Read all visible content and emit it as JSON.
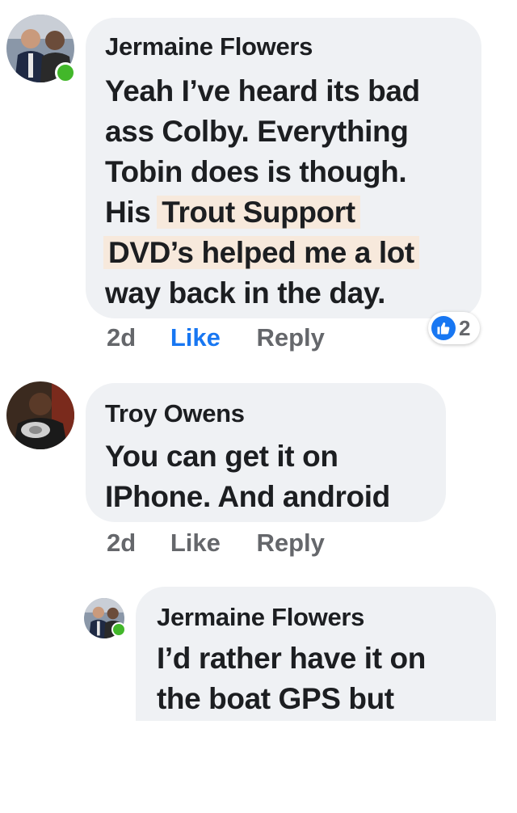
{
  "comments": [
    {
      "author": "Jermaine Flowers",
      "lines": [
        {
          "pre": "Yeah I’ve heard its bad",
          "hl": ""
        },
        {
          "pre": "ass Colby. Everything",
          "hl": ""
        },
        {
          "pre": "Tobin does is though.",
          "hl": ""
        },
        {
          "pre": "His",
          "hl": "Trout Support"
        },
        {
          "pre": "",
          "hl": "DVD’s helped me a lot"
        },
        {
          "pre": "way back in the day.",
          "hl": ""
        }
      ],
      "time": "2d",
      "like_label": "Like",
      "reply_label": "Reply",
      "reaction_count": "2",
      "online": true
    },
    {
      "author": "Troy Owens",
      "lines": [
        {
          "pre": "You can get it on",
          "hl": ""
        },
        {
          "pre": "IPhone. And android",
          "hl": ""
        }
      ],
      "time": "2d",
      "like_label": "Like",
      "reply_label": "Reply",
      "online": false
    },
    {
      "author": "Jermaine Flowers",
      "lines": [
        {
          "pre": "I’d rather have it on",
          "hl": ""
        },
        {
          "pre": "the boat GPS but",
          "hl": ""
        }
      ],
      "online": true
    }
  ],
  "colors": {
    "bubble": "#eff1f4",
    "like_active": "#1877f2",
    "muted": "#65676b",
    "online": "#42b72a",
    "highlight": "#f7e9dc"
  }
}
